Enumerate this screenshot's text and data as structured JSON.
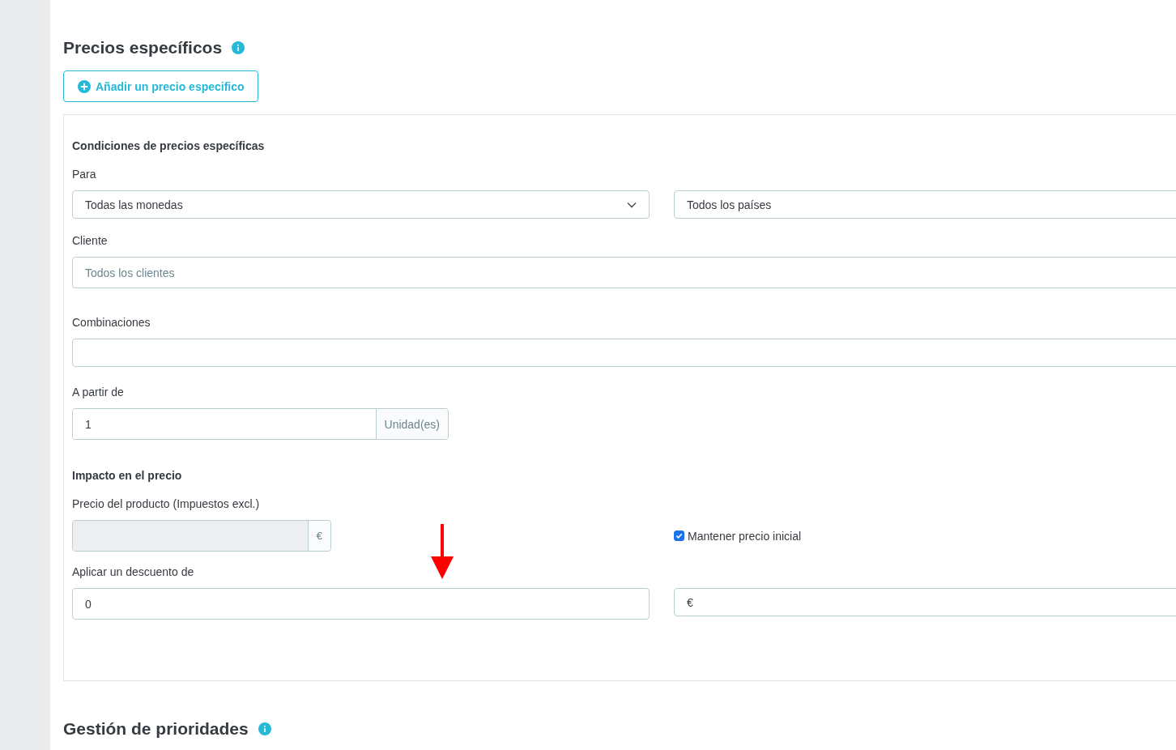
{
  "title": "Precios específicos",
  "add_button": "Añadir un precio especifico",
  "conditions": {
    "heading": "Condiciones de precios específicas",
    "para_label": "Para",
    "currency": "Todas las monedas",
    "country": "Todos los países",
    "customer_label": "Cliente",
    "customer_placeholder": "Todos los clientes",
    "combinations_label": "Combinaciones",
    "from_label": "A partir de",
    "from_value": "1",
    "from_unit": "Unidad(es)"
  },
  "impact": {
    "heading": "Impacto en el precio",
    "price_label": "Precio del producto (Impuestos excl.)",
    "price_unit": "€",
    "keep_initial": {
      "label": "Mantener precio inicial",
      "checked": true
    },
    "discount_label": "Aplicar un descuento de",
    "discount_value": "0",
    "discount_type": "€"
  },
  "priorities_title": "Gestión de prioridades"
}
